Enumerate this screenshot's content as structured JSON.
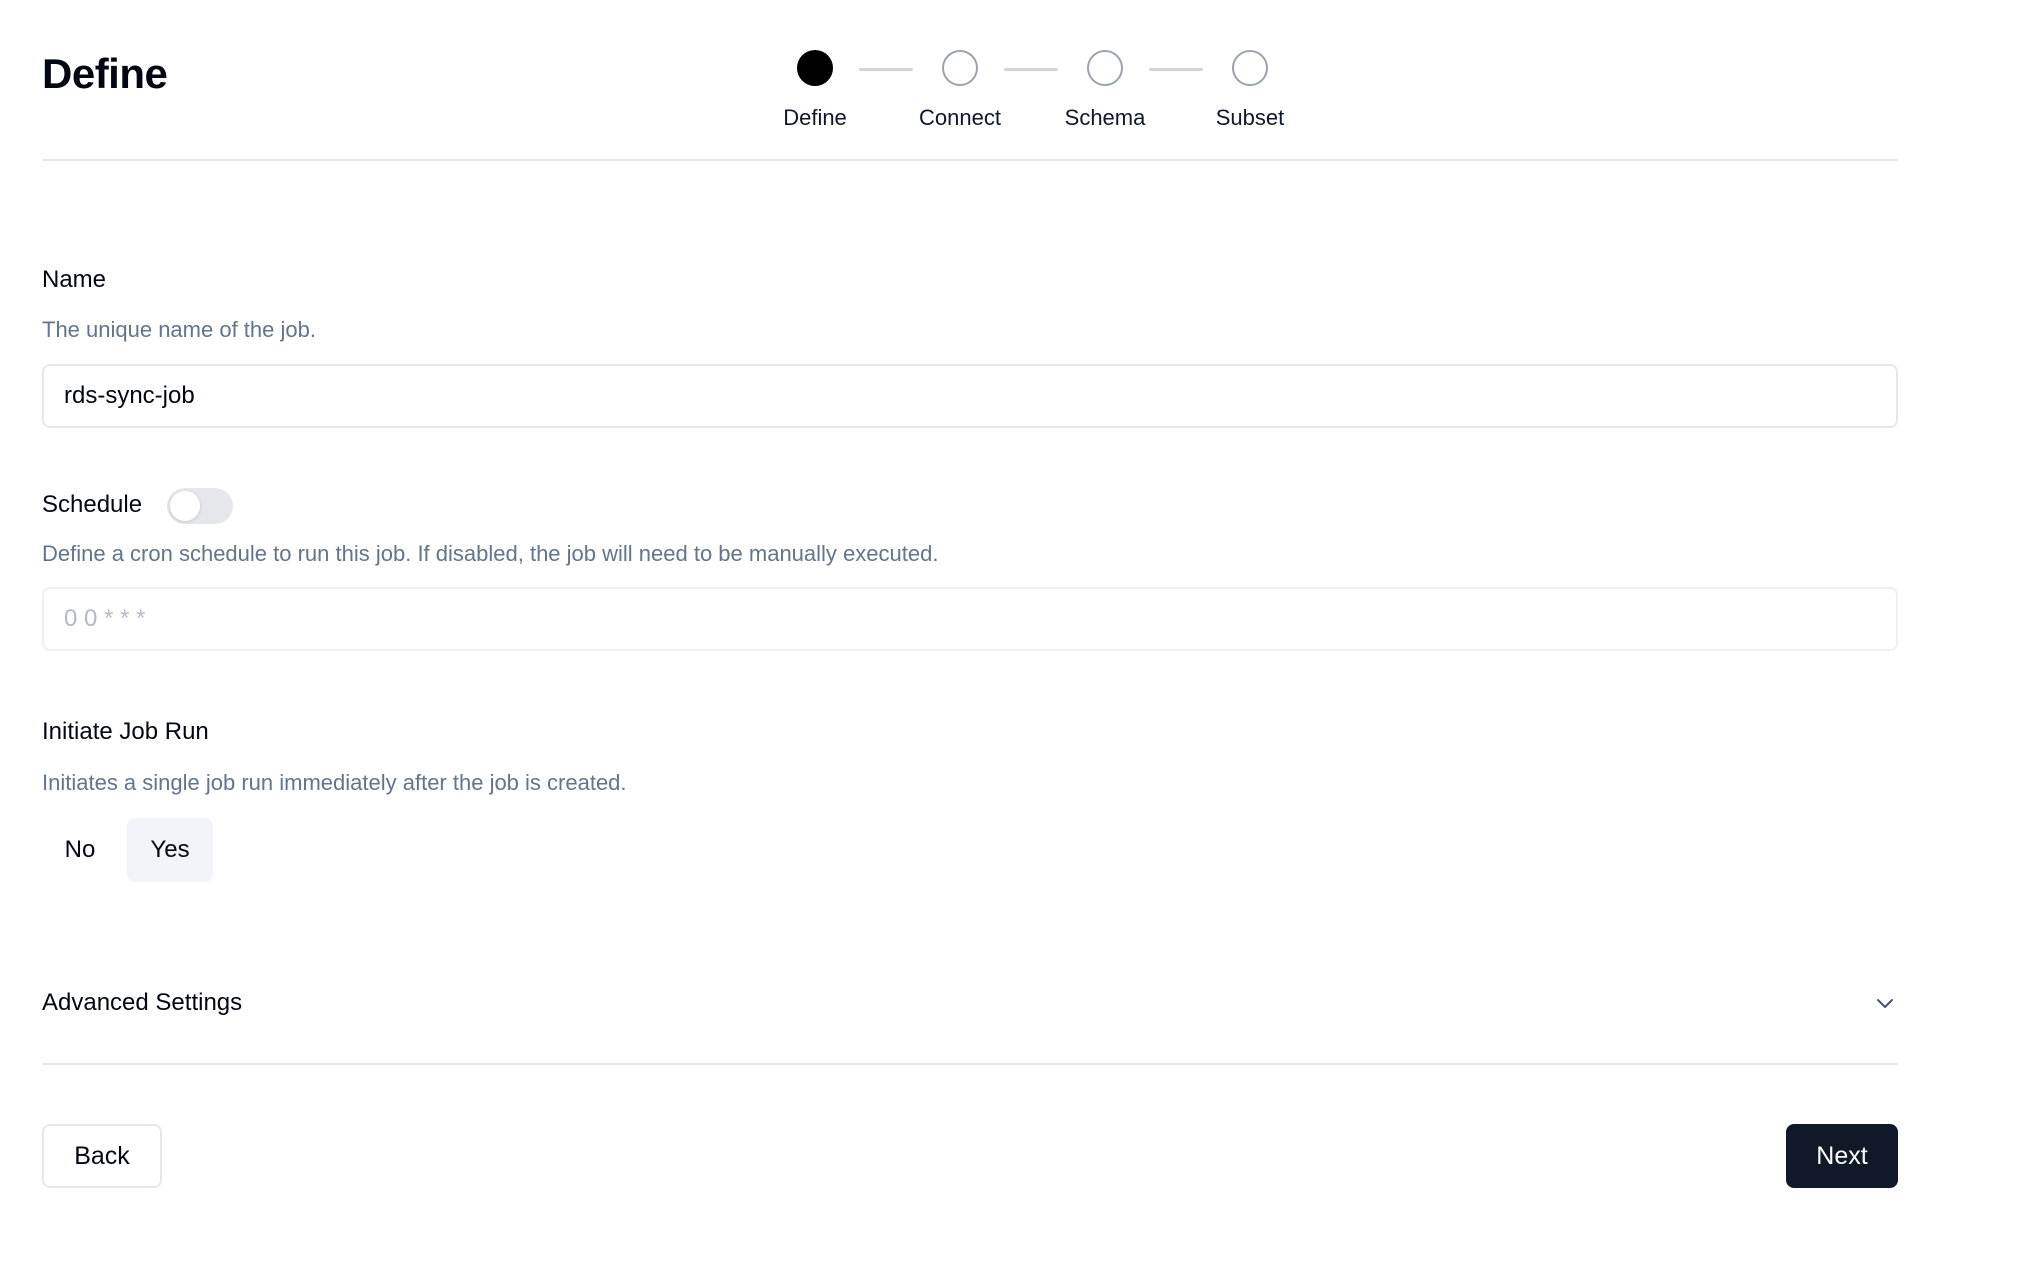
{
  "page": {
    "title": "Define"
  },
  "stepper": {
    "steps": [
      {
        "label": "Define",
        "state": "active"
      },
      {
        "label": "Connect",
        "state": "pending"
      },
      {
        "label": "Schema",
        "state": "pending"
      },
      {
        "label": "Subset",
        "state": "pending"
      }
    ]
  },
  "form": {
    "name": {
      "label": "Name",
      "description": "The unique name of the job.",
      "value": "rds-sync-job"
    },
    "schedule": {
      "label": "Schedule",
      "enabled": false,
      "description": "Define a cron schedule to run this job. If disabled, the job will need to be manually executed.",
      "placeholder": "0 0 * * *",
      "value": ""
    },
    "initiate_job_run": {
      "label": "Initiate Job Run",
      "description": "Initiates a single job run immediately after the job is created.",
      "options": [
        "No",
        "Yes"
      ],
      "selected": "Yes"
    },
    "advanced": {
      "label": "Advanced Settings",
      "icon": "chevron-down-icon"
    }
  },
  "footer": {
    "back_label": "Back",
    "next_label": "Next"
  },
  "colors": {
    "primary_button": "#111827",
    "step_active": "#000000",
    "muted_text": "#64748b",
    "border": "#e5e7eb"
  }
}
